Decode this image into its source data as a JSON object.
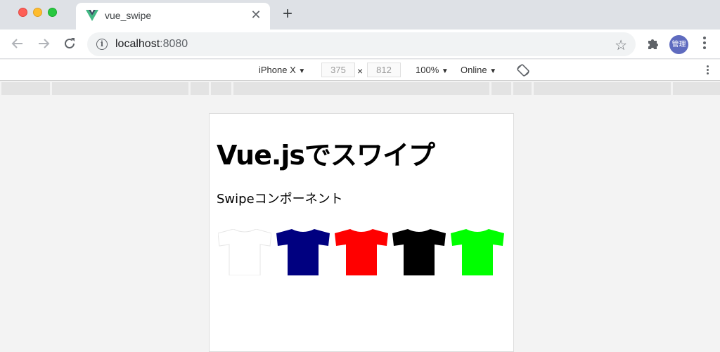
{
  "tab": {
    "title": "vue_swipe"
  },
  "address": {
    "host": "localhost",
    "port": ":8080"
  },
  "profile": {
    "avatar_text": "管理"
  },
  "device_toolbar": {
    "device": "iPhone X",
    "width": "375",
    "times": "×",
    "height": "812",
    "zoom": "100%",
    "network": "Online",
    "arrow": "▼"
  },
  "page": {
    "heading": "Vue.jsでスワイプ",
    "subheading": "Swipeコンポーネント",
    "shirts": [
      {
        "name": "white-tshirt",
        "color": "#ffffff"
      },
      {
        "name": "navy-tshirt",
        "color": "#000080"
      },
      {
        "name": "red-tshirt",
        "color": "#ff0000"
      },
      {
        "name": "black-tshirt",
        "color": "#000000"
      },
      {
        "name": "green-tshirt",
        "color": "#00ff00"
      }
    ]
  }
}
